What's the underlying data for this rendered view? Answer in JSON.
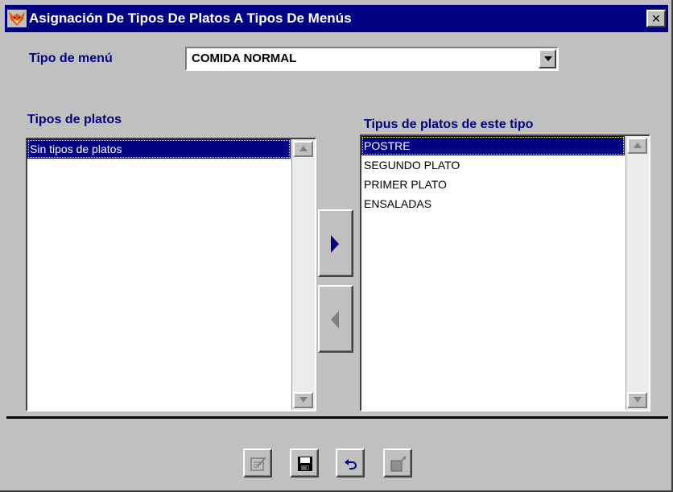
{
  "window": {
    "title": "Asignación De Tipos De Platos A Tipos De Menús",
    "app_icon": "fox-icon",
    "close_glyph": "✕"
  },
  "menu_type": {
    "label": "Tipo de menú",
    "selected": "COMIDA NORMAL"
  },
  "available_list": {
    "label": "Tipos de platos",
    "items": [
      "Sin tipos de platos"
    ],
    "selected_index": 0
  },
  "assigned_list": {
    "label": "Tipus de platos de este tipo",
    "items": [
      "POSTRE",
      "SEGUNDO PLATO",
      "PRIMER PLATO",
      "ENSALADAS"
    ],
    "selected_index": 0
  },
  "move_buttons": [
    "arrow-right-icon",
    "arrow-left-icon"
  ],
  "toolbar": [
    "edit-icon",
    "save-icon",
    "undo-icon",
    "exit-icon"
  ],
  "colors": {
    "title_bar": "#000080",
    "label": "#000080",
    "selection": "#000080",
    "face": "#c0c0c0"
  }
}
